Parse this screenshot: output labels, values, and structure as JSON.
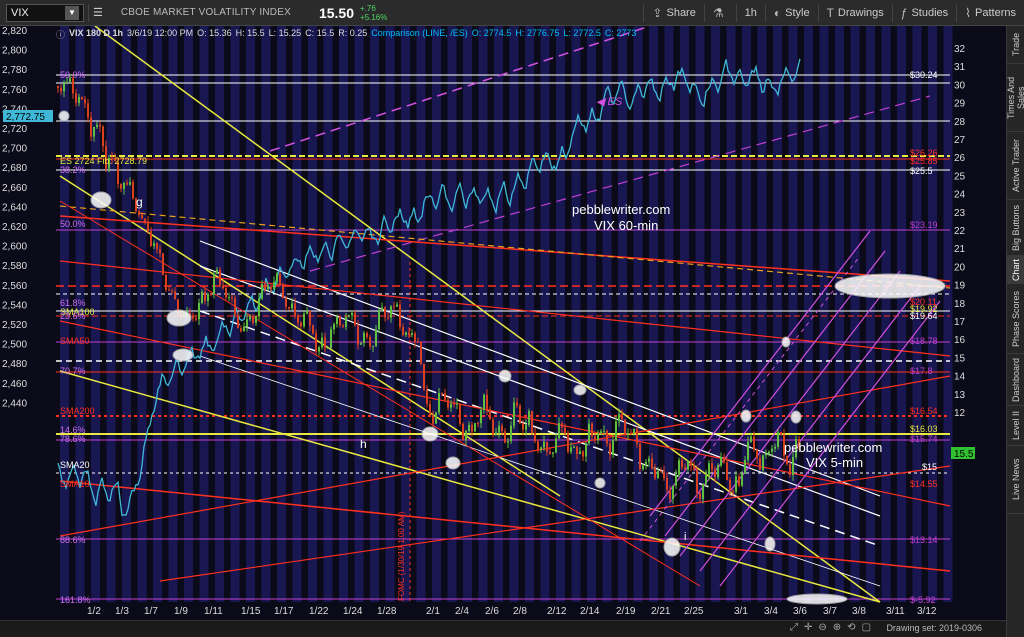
{
  "toolbar": {
    "symbol": "VIX",
    "description": "CBOE MARKET VOLATILITY INDEX",
    "last": "15.50",
    "change_abs": "+.76",
    "change_pct": "+5.16%",
    "share_label": "Share",
    "timeframe": "1h",
    "style_label": "Style",
    "drawings_label": "Drawings",
    "studies_label": "Studies",
    "patterns_label": "Patterns"
  },
  "header": {
    "study": "VIX 180 D 1h",
    "date": "3/6/19 12:00 PM",
    "open": "O: 15.36",
    "high": "H: 15.5",
    "low": "L: 15.25",
    "close": "C: 15.5",
    "range": "R: 0.25",
    "comparison": "Comparison (LINE, /ES)",
    "cmp_open": "O: 2774.5",
    "cmp_high": "H: 2776.75",
    "cmp_low": "L: 2772.5",
    "cmp_close": "C: 2773"
  },
  "right_rail": {
    "tabs": [
      "Trade",
      "Times And Sales",
      "Active Trader",
      "Big Buttons",
      "Chart",
      "Phase Scores",
      "Dashboard",
      "Level II",
      "Live News"
    ],
    "active": "Chart"
  },
  "left_axis": {
    "labels": [
      "2,820",
      "2,800",
      "2,780",
      "2,760",
      "2,740",
      "2,720",
      "2,700",
      "2,680",
      "2,660",
      "2,640",
      "2,620",
      "2,600",
      "2,580",
      "2,560",
      "2,540",
      "2,520",
      "2,500",
      "2,480",
      "2,460",
      "2,440"
    ],
    "current": "2,772.75"
  },
  "right_axis": {
    "labels": [
      "32",
      "31",
      "30",
      "29",
      "28",
      "27",
      "26",
      "25",
      "24",
      "23",
      "22",
      "21",
      "20",
      "19",
      "18",
      "17",
      "16",
      "15",
      "14",
      "13",
      "12"
    ],
    "current": "15.5"
  },
  "x_axis": {
    "labels": [
      "1/2",
      "1/3",
      "1/7",
      "1/9",
      "1/11",
      "1/15",
      "1/17",
      "1/22",
      "1/24",
      "1/28",
      "2/1",
      "2/4",
      "2/6",
      "2/8",
      "2/12",
      "2/14",
      "2/19",
      "2/21",
      "2/25",
      "3/1",
      "3/4",
      "3/6",
      "3/7",
      "3/8",
      "3/11",
      "3/12"
    ]
  },
  "annotations": {
    "left_levels": [
      "50.0%",
      "38.2%",
      "ES 2724 Fib: 2728.79",
      "50.0%",
      "61.8%",
      "SMA100",
      "23.6%",
      "SMA50",
      "70.7%",
      "SMA200",
      "14.6%",
      "78.6%",
      "SMA20",
      "SMA10",
      "88.6%",
      "161.8%"
    ],
    "right_levels": [
      "$30.24",
      "$26.26",
      "$25.85",
      "$25.5",
      "$23.19",
      "$20.11",
      "$19.92",
      "$19.64",
      "$18.78",
      "$17.8",
      "$16.54",
      "$16.03",
      "$15.74",
      "$15",
      "$14.55",
      "$13.14",
      "$-5.92"
    ],
    "brand_top": "pebblewriter.com",
    "brand_top_sub": "VIX 60-min",
    "brand_mid": "pebblewriter.com",
    "brand_mid_sub": "VIX 5-min",
    "es_tag": "ES",
    "fomc": "FOMC (1/30/19 1:00 AM)",
    "label_g": "g",
    "label_h": "h",
    "label_i": "i"
  },
  "bottom": {
    "drawing_set": "Drawing set: 2019-0306"
  },
  "colors": {
    "bg": "#0a0a18",
    "stripe": "#1c1a5c",
    "es_line": "#3fb8d8",
    "candle_up": "#5fbf3f",
    "candle_down": "#d94020",
    "fib": "#c040d0",
    "red_line": "#ff3020",
    "yellow_line": "#e8e840"
  }
}
